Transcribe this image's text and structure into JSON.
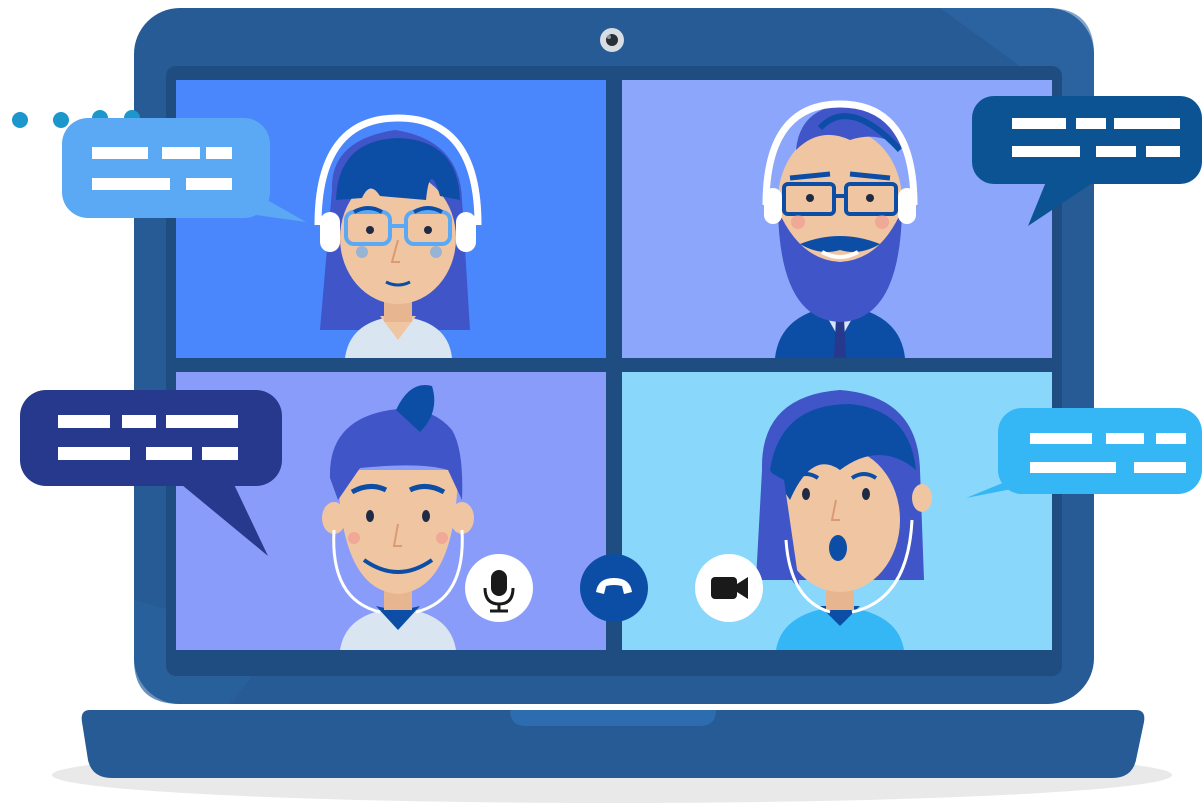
{
  "colors": {
    "laptop_frame": "#275b95",
    "laptop_dark": "#1f4d82",
    "tile_top_left": "#4a86fc",
    "tile_top_right": "#8ba6fb",
    "tile_bottom_left": "#8a9cfa",
    "tile_bottom_right": "#89d8fc",
    "skin": "#f0c5a2",
    "hair_primary": "#3f55c8",
    "hair_dark": "#0c4ea6",
    "end_call": "#0c4ea6",
    "bubble_light_blue": "#5ba8f5",
    "bubble_navy": "#0b5393",
    "bubble_indigo": "#27398c",
    "bubble_sky": "#35b6f5",
    "dots": "#1b97cb"
  },
  "participants": [
    {
      "id": "woman-glasses-headset",
      "tile": "top-left"
    },
    {
      "id": "bearded-man-headset",
      "tile": "top-right"
    },
    {
      "id": "smiling-man-earphones",
      "tile": "bottom-left"
    },
    {
      "id": "surprised-woman-earphones",
      "tile": "bottom-right"
    }
  ],
  "controls": [
    {
      "id": "mute",
      "icon": "microphone-icon"
    },
    {
      "id": "hang-up",
      "icon": "phone-hangup-icon"
    },
    {
      "id": "camera",
      "icon": "video-camera-icon"
    }
  ],
  "speech_bubbles": [
    {
      "icon": "speech-bubble-icon",
      "color": "light-blue"
    },
    {
      "icon": "speech-bubble-icon",
      "color": "navy"
    },
    {
      "icon": "speech-bubble-icon",
      "color": "indigo"
    },
    {
      "icon": "speech-bubble-icon",
      "color": "sky"
    }
  ]
}
